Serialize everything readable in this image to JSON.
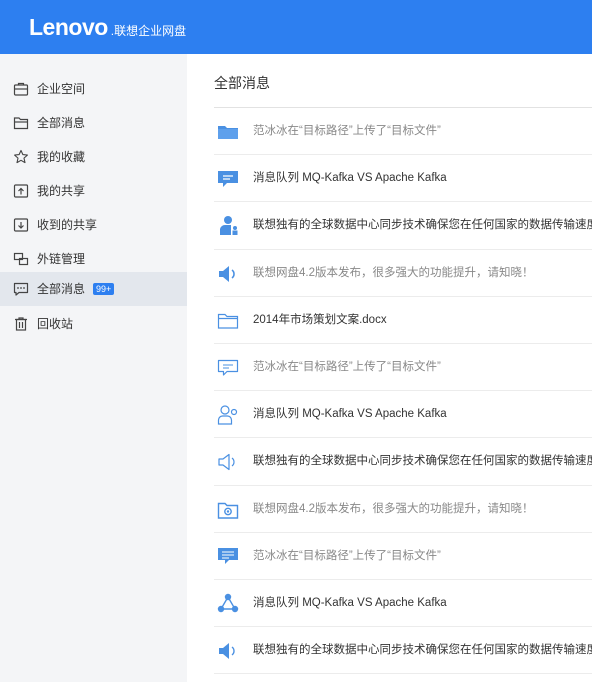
{
  "header": {
    "logo": "Lenovo",
    "logo_sub": ".联想企业网盘"
  },
  "sidebar": {
    "items": [
      {
        "label": "企业空间"
      },
      {
        "label": "全部消息"
      },
      {
        "label": "我的收藏"
      },
      {
        "label": "我的共享"
      },
      {
        "label": "收到的共享"
      },
      {
        "label": "外链管理"
      },
      {
        "label": "全部消息",
        "badge": "99+"
      },
      {
        "label": "回收站"
      }
    ]
  },
  "main": {
    "title": "全部消息",
    "messages": [
      {
        "icon": "folder-icon",
        "text": "范冰冰在“目标路径”上传了“目标文件”",
        "read": true
      },
      {
        "icon": "chat-icon",
        "text": "消息队列 MQ-Kafka VS Apache Kafka",
        "read": false
      },
      {
        "icon": "users-icon",
        "text": "联想独有的全球数据中心同步技术确保您在任何国家的数据传输速度",
        "read": false
      },
      {
        "icon": "speaker-icon",
        "text": "联想网盘4.2版本发布，很多强大的功能提升，请知晓！",
        "read": true
      },
      {
        "icon": "folder-outline-icon",
        "text": "2014年市场策划文案.docx",
        "read": false
      },
      {
        "icon": "chat-outline-icon",
        "text": "范冰冰在“目标路径”上传了“目标文件”",
        "read": true
      },
      {
        "icon": "users-outline-icon",
        "text": "消息队列 MQ-Kafka VS Apache Kafka",
        "read": false
      },
      {
        "icon": "speaker-outline-icon",
        "text": "联想独有的全球数据中心同步技术确保您在任何国家的数据传输速度",
        "read": false
      },
      {
        "icon": "camera-folder-icon",
        "text": "联想网盘4.2版本发布，很多强大的功能提升，请知晓！",
        "read": true
      },
      {
        "icon": "chat-lines-icon",
        "text": "范冰冰在“目标路径”上传了“目标文件”",
        "read": true
      },
      {
        "icon": "share-nodes-icon",
        "text": "消息队列 MQ-Kafka VS Apache Kafka",
        "read": false
      },
      {
        "icon": "speaker-icon",
        "text": "联想独有的全球数据中心同步技术确保您在任何国家的数据传输速度",
        "read": false
      }
    ]
  },
  "colors": {
    "brand": "#2d7ff0",
    "icon_blue": "#4a90e2",
    "sidebar_bg": "#f4f5f7"
  }
}
